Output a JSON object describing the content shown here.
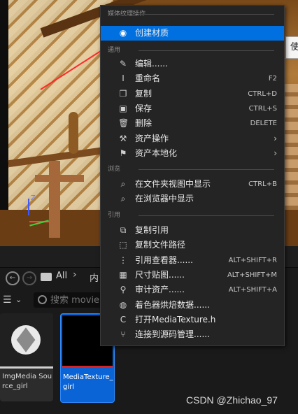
{
  "viewport": {
    "axis_label": "Z",
    "tooltip_edge_text": "使"
  },
  "content_browser": {
    "back_glyph": "←",
    "forward_glyph": "→",
    "breadcrumb": [
      "All",
      "内"
    ],
    "breadcrumb_separator": "›",
    "search_placeholder": "搜索 movie",
    "assets": [
      {
        "label": "ImgMedia Source_girl",
        "selected": false
      },
      {
        "label": "MediaTexture_ girl",
        "selected": true
      }
    ],
    "watermark": "CSDN @Zhichao_97"
  },
  "context_menu": {
    "sections": [
      {
        "title": "媒体纹理操作",
        "items": [
          {
            "label": "创建材质",
            "shortcut": "",
            "icon": "create-material-icon",
            "selected": true
          }
        ]
      },
      {
        "title": "通用",
        "items": [
          {
            "label": "编辑......",
            "shortcut": "",
            "icon": "pencil-icon"
          },
          {
            "label": "重命名",
            "shortcut": "F2",
            "icon": "rename-icon"
          },
          {
            "label": "复制",
            "shortcut": "CTRL+D",
            "icon": "duplicate-icon"
          },
          {
            "label": "保存",
            "shortcut": "CTRL+S",
            "icon": "save-icon"
          },
          {
            "label": "删除",
            "shortcut": "DELETE",
            "icon": "trash-icon"
          },
          {
            "label": "资产操作",
            "shortcut": "",
            "icon": "wrench-icon",
            "submenu": true
          },
          {
            "label": "资产本地化",
            "shortcut": "",
            "icon": "flag-icon",
            "submenu": true
          }
        ]
      },
      {
        "title": "浏览",
        "items": [
          {
            "label": "在文件夹视图中显示",
            "shortcut": "CTRL+B",
            "icon": "folder-search-icon"
          },
          {
            "label": "在浏览器中显示",
            "shortcut": "",
            "icon": "browser-search-icon"
          }
        ]
      },
      {
        "title": "引用",
        "items": [
          {
            "label": "复制引用",
            "shortcut": "",
            "icon": "copy-reference-icon"
          },
          {
            "label": "复制文件路径",
            "shortcut": "",
            "icon": "copy-path-icon"
          },
          {
            "label": "引用查看器......",
            "shortcut": "ALT+SHIFT+R",
            "icon": "reference-viewer-icon"
          },
          {
            "label": "尺寸贴图......",
            "shortcut": "ALT+SHIFT+M",
            "icon": "size-map-icon"
          },
          {
            "label": "审计资产......",
            "shortcut": "ALT+SHIFT+A",
            "icon": "audit-icon"
          },
          {
            "label": "着色器烘焙数据......",
            "shortcut": "",
            "icon": "shader-icon"
          },
          {
            "label": "打开MediaTexture.h",
            "shortcut": "",
            "icon": "cpp-file-icon"
          },
          {
            "label": "连接到源码管理......",
            "shortcut": "",
            "icon": "source-control-icon"
          }
        ]
      }
    ]
  }
}
